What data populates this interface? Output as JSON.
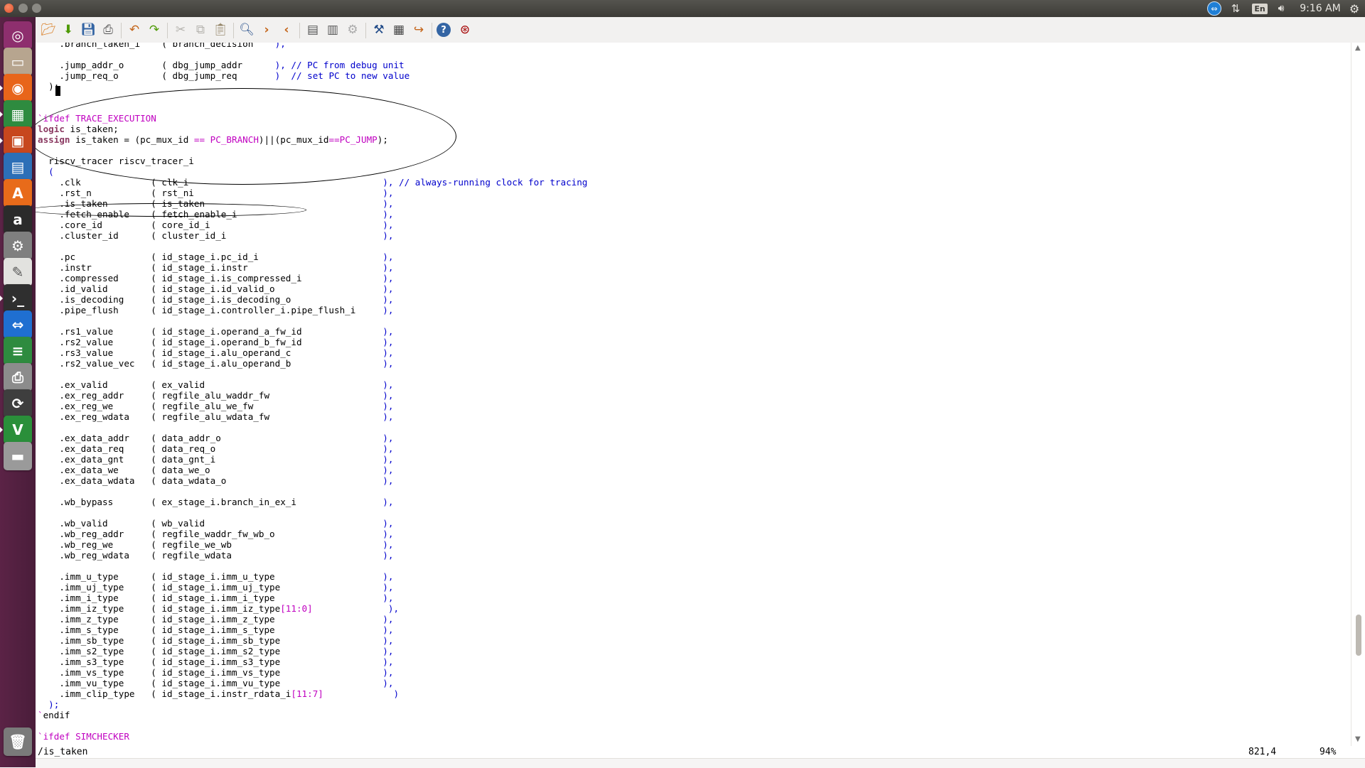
{
  "topbar": {
    "clock": "9:16 AM",
    "language": "En",
    "icons": [
      "teamviewer-icon",
      "network-icon",
      "keyboard-language-icon",
      "volume-icon",
      "session-gear-icon"
    ]
  },
  "launcher": {
    "items": [
      {
        "name": "dash",
        "color": "#8e2f6e"
      },
      {
        "name": "files",
        "color": "#b7a58f"
      },
      {
        "name": "firefox",
        "color": "#e8651a"
      },
      {
        "name": "libreoffice-calc",
        "color": "#2e8b3f"
      },
      {
        "name": "libreoffice-impress",
        "color": "#c7471e"
      },
      {
        "name": "libreoffice-writer",
        "color": "#2c6fb7"
      },
      {
        "name": "ubuntu-software",
        "color": "#e86b1a"
      },
      {
        "name": "amazon",
        "label": "a",
        "color": "#2b2b2b"
      },
      {
        "name": "system-settings",
        "color": "#7f7f7f"
      },
      {
        "name": "text-editor",
        "color": "#e2e2df"
      },
      {
        "name": "terminal",
        "color": "#2f2f2f"
      },
      {
        "name": "teamviewer",
        "color": "#1f6fd1"
      },
      {
        "name": "modelsim",
        "color": "#2e8b3f"
      },
      {
        "name": "printer",
        "color": "#8c8c8c"
      },
      {
        "name": "software-updater",
        "color": "#3e3e3e"
      },
      {
        "name": "gvim",
        "color": "#2a8f3a"
      },
      {
        "name": "drive",
        "color": "#9a9a9a"
      },
      {
        "name": "trash",
        "color": "#7a7a7a"
      }
    ]
  },
  "toolbar": {
    "buttons": [
      "open",
      "save-session",
      "save",
      "print",
      "undo",
      "redo",
      "cut",
      "copy",
      "paste",
      "find-replace",
      "find-next",
      "find-previous",
      "load-session",
      "save-session-file",
      "run-script",
      "make",
      "build-tags",
      "jump-to-tag",
      "help",
      "find-help"
    ]
  },
  "editor": {
    "lines": [
      [
        {
          "t": "    .branch_taken_i    ( branch_decision    "
        },
        {
          "t": "),",
          "c": "p"
        }
      ],
      [],
      [
        {
          "t": "    .jump_addr_o       ( dbg_jump_addr      "
        },
        {
          "t": "),",
          "c": "p"
        },
        {
          "t": " // PC from debug unit",
          "c": "c"
        }
      ],
      [
        {
          "t": "    .jump_req_o        ( dbg_jump_req       "
        },
        {
          "t": ")  // set PC to new value",
          "c": "c"
        }
      ],
      [
        {
          "t": "  );"
        }
      ],
      [],
      [],
      [
        {
          "t": "`",
          "c": "k"
        },
        {
          "t": "ifdef TRACE_EXECUTION",
          "c": "k"
        }
      ],
      [
        {
          "t": "logic",
          "c": "kw"
        },
        {
          "t": " is_taken;"
        }
      ],
      [
        {
          "t": "assign",
          "c": "kw"
        },
        {
          "t": " is_taken = (pc_mux_id "
        },
        {
          "t": "==",
          "c": "k"
        },
        {
          "t": " "
        },
        {
          "t": "PC_BRANCH",
          "c": "k"
        },
        {
          "t": ")||(pc_mux_id"
        },
        {
          "t": "==",
          "c": "k"
        },
        {
          "t": "PC_JUMP",
          "c": "k"
        },
        {
          "t": ");"
        }
      ],
      [],
      [
        {
          "t": "  riscv_tracer riscv_tracer_i"
        }
      ],
      [
        {
          "t": "  (",
          "c": "p"
        }
      ],
      [
        {
          "t": "    .clk             ( clk_i                                    "
        },
        {
          "t": "),",
          "c": "p"
        },
        {
          "t": " // always-running clock for tracing",
          "c": "c"
        }
      ],
      [
        {
          "t": "    .rst_n           ( rst_ni                                   "
        },
        {
          "t": "),",
          "c": "p"
        }
      ],
      [
        {
          "t": "    .is_taken        ( is_taken                                 "
        },
        {
          "t": "),",
          "c": "p"
        }
      ],
      [
        {
          "t": "    .fetch_enable    ( fetch_enable_i                           "
        },
        {
          "t": "),",
          "c": "p"
        }
      ],
      [
        {
          "t": "    .core_id         ( core_id_i                                "
        },
        {
          "t": "),",
          "c": "p"
        }
      ],
      [
        {
          "t": "    .cluster_id      ( cluster_id_i                             "
        },
        {
          "t": "),",
          "c": "p"
        }
      ],
      [],
      [
        {
          "t": "    .pc              ( id_stage_i.pc_id_i                       "
        },
        {
          "t": "),",
          "c": "p"
        }
      ],
      [
        {
          "t": "    .instr           ( id_stage_i.instr                         "
        },
        {
          "t": "),",
          "c": "p"
        }
      ],
      [
        {
          "t": "    .compressed      ( id_stage_i.is_compressed_i               "
        },
        {
          "t": "),",
          "c": "p"
        }
      ],
      [
        {
          "t": "    .id_valid        ( id_stage_i.id_valid_o                    "
        },
        {
          "t": "),",
          "c": "p"
        }
      ],
      [
        {
          "t": "    .is_decoding     ( id_stage_i.is_decoding_o                 "
        },
        {
          "t": "),",
          "c": "p"
        }
      ],
      [
        {
          "t": "    .pipe_flush      ( id_stage_i.controller_i.pipe_flush_i     "
        },
        {
          "t": "),",
          "c": "p"
        }
      ],
      [],
      [
        {
          "t": "    .rs1_value       ( id_stage_i.operand_a_fw_id               "
        },
        {
          "t": "),",
          "c": "p"
        }
      ],
      [
        {
          "t": "    .rs2_value       ( id_stage_i.operand_b_fw_id               "
        },
        {
          "t": "),",
          "c": "p"
        }
      ],
      [
        {
          "t": "    .rs3_value       ( id_stage_i.alu_operand_c                 "
        },
        {
          "t": "),",
          "c": "p"
        }
      ],
      [
        {
          "t": "    .rs2_value_vec   ( id_stage_i.alu_operand_b                 "
        },
        {
          "t": "),",
          "c": "p"
        }
      ],
      [],
      [
        {
          "t": "    .ex_valid        ( ex_valid                                 "
        },
        {
          "t": "),",
          "c": "p"
        }
      ],
      [
        {
          "t": "    .ex_reg_addr     ( regfile_alu_waddr_fw                     "
        },
        {
          "t": "),",
          "c": "p"
        }
      ],
      [
        {
          "t": "    .ex_reg_we       ( regfile_alu_we_fw                        "
        },
        {
          "t": "),",
          "c": "p"
        }
      ],
      [
        {
          "t": "    .ex_reg_wdata    ( regfile_alu_wdata_fw                     "
        },
        {
          "t": "),",
          "c": "p"
        }
      ],
      [],
      [
        {
          "t": "    .ex_data_addr    ( data_addr_o                              "
        },
        {
          "t": "),",
          "c": "p"
        }
      ],
      [
        {
          "t": "    .ex_data_req     ( data_req_o                               "
        },
        {
          "t": "),",
          "c": "p"
        }
      ],
      [
        {
          "t": "    .ex_data_gnt     ( data_gnt_i                               "
        },
        {
          "t": "),",
          "c": "p"
        }
      ],
      [
        {
          "t": "    .ex_data_we      ( data_we_o                                "
        },
        {
          "t": "),",
          "c": "p"
        }
      ],
      [
        {
          "t": "    .ex_data_wdata   ( data_wdata_o                             "
        },
        {
          "t": "),",
          "c": "p"
        }
      ],
      [],
      [
        {
          "t": "    .wb_bypass       ( ex_stage_i.branch_in_ex_i                "
        },
        {
          "t": "),",
          "c": "p"
        }
      ],
      [],
      [
        {
          "t": "    .wb_valid        ( wb_valid                                 "
        },
        {
          "t": "),",
          "c": "p"
        }
      ],
      [
        {
          "t": "    .wb_reg_addr     ( regfile_waddr_fw_wb_o                    "
        },
        {
          "t": "),",
          "c": "p"
        }
      ],
      [
        {
          "t": "    .wb_reg_we       ( regfile_we_wb                            "
        },
        {
          "t": "),",
          "c": "p"
        }
      ],
      [
        {
          "t": "    .wb_reg_wdata    ( regfile_wdata                            "
        },
        {
          "t": "),",
          "c": "p"
        }
      ],
      [],
      [
        {
          "t": "    .imm_u_type      ( id_stage_i.imm_u_type                    "
        },
        {
          "t": "),",
          "c": "p"
        }
      ],
      [
        {
          "t": "    .imm_uj_type     ( id_stage_i.imm_uj_type                   "
        },
        {
          "t": "),",
          "c": "p"
        }
      ],
      [
        {
          "t": "    .imm_i_type      ( id_stage_i.imm_i_type                    "
        },
        {
          "t": "),",
          "c": "p"
        }
      ],
      [
        {
          "t": "    .imm_iz_type     ( id_stage_i.imm_iz_type"
        },
        {
          "t": "[11:0]",
          "c": "k"
        },
        {
          "t": "              "
        },
        {
          "t": "),",
          "c": "p"
        }
      ],
      [
        {
          "t": "    .imm_z_type      ( id_stage_i.imm_z_type                    "
        },
        {
          "t": "),",
          "c": "p"
        }
      ],
      [
        {
          "t": "    .imm_s_type      ( id_stage_i.imm_s_type                    "
        },
        {
          "t": "),",
          "c": "p"
        }
      ],
      [
        {
          "t": "    .imm_sb_type     ( id_stage_i.imm_sb_type                   "
        },
        {
          "t": "),",
          "c": "p"
        }
      ],
      [
        {
          "t": "    .imm_s2_type     ( id_stage_i.imm_s2_type                   "
        },
        {
          "t": "),",
          "c": "p"
        }
      ],
      [
        {
          "t": "    .imm_s3_type     ( id_stage_i.imm_s3_type                   "
        },
        {
          "t": "),",
          "c": "p"
        }
      ],
      [
        {
          "t": "    .imm_vs_type     ( id_stage_i.imm_vs_type                   "
        },
        {
          "t": "),",
          "c": "p"
        }
      ],
      [
        {
          "t": "    .imm_vu_type     ( id_stage_i.imm_vu_type                   "
        },
        {
          "t": "),",
          "c": "p"
        }
      ],
      [
        {
          "t": "    .imm_clip_type   ( id_stage_i.instr_rdata_i"
        },
        {
          "t": "[11:7]",
          "c": "k"
        },
        {
          "t": "             "
        },
        {
          "t": ")",
          "c": "p"
        }
      ],
      [
        {
          "t": "  );",
          "c": "p"
        }
      ],
      [
        {
          "t": "`",
          "c": "k"
        },
        {
          "t": "endif"
        }
      ],
      [],
      [
        {
          "t": "`",
          "c": "k"
        },
        {
          "t": "ifdef SIMCHECKER",
          "c": "k"
        }
      ]
    ]
  },
  "statusline": {
    "command": "/is_taken",
    "cursor_position": "821,4",
    "scroll_percent": "94%"
  }
}
